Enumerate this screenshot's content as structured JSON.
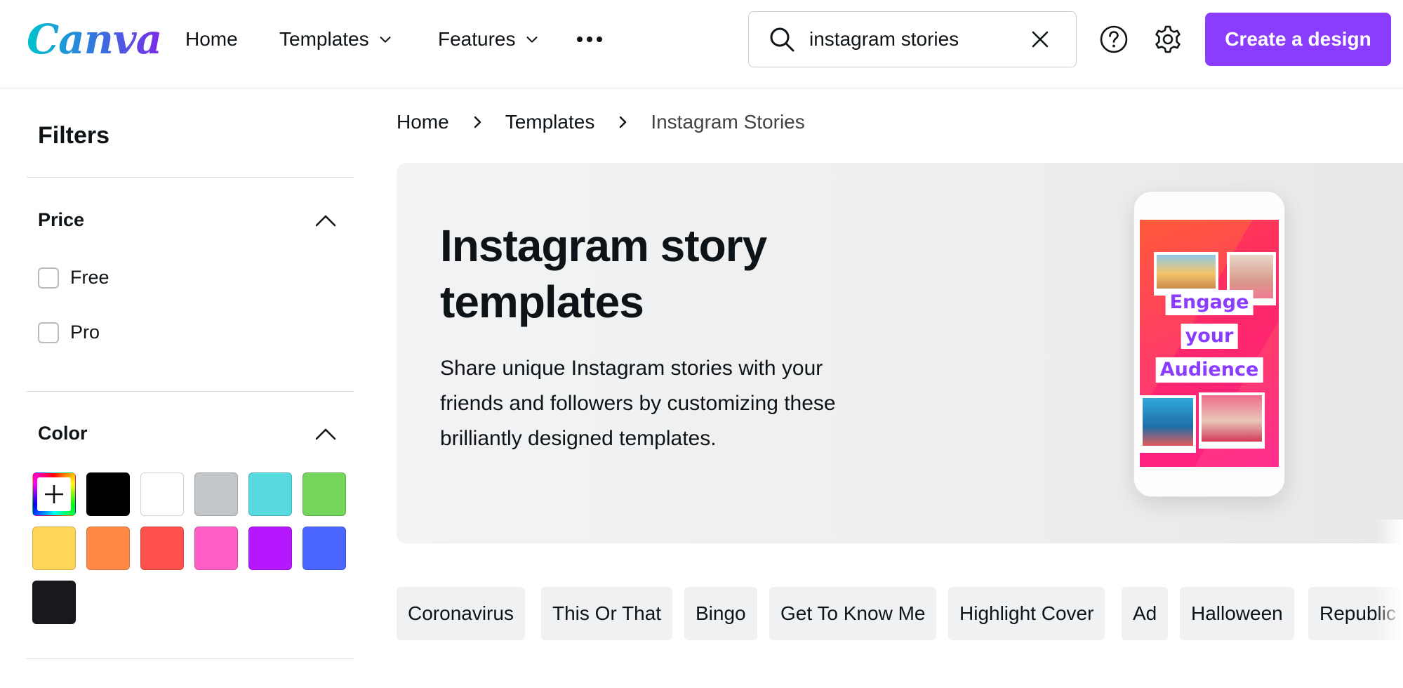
{
  "header": {
    "logo_text": "Canva",
    "nav": [
      {
        "label": "Home",
        "has_dropdown": false
      },
      {
        "label": "Templates",
        "has_dropdown": true
      },
      {
        "label": "Features",
        "has_dropdown": true
      }
    ],
    "more_icon": "more-horizontal-icon",
    "search": {
      "value": "instagram stories",
      "placeholder": "Search"
    },
    "icons": [
      "search-icon",
      "close-icon",
      "help-icon",
      "gear-icon"
    ],
    "cta_label": "Create a design",
    "accent_color": "#8b3dff"
  },
  "sidebar": {
    "title": "Filters",
    "price": {
      "title": "Price",
      "options": [
        {
          "label": "Free",
          "checked": false
        },
        {
          "label": "Pro",
          "checked": false
        }
      ]
    },
    "color": {
      "title": "Color",
      "swatches": [
        "custom",
        "#000000",
        "#ffffff",
        "#c4c7ca",
        "#57d9e0",
        "#73d559",
        "#ffd659",
        "#ff8a48",
        "#ff524e",
        "#ff5ec6",
        "#b517ff",
        "#4b66ff",
        "#17191c"
      ]
    }
  },
  "breadcrumb": {
    "items": [
      "Home",
      "Templates",
      "Instagram Stories"
    ]
  },
  "hero": {
    "title": "Instagram story templates",
    "description": "Share unique Instagram stories with your friends and followers by customizing these brilliantly designed templates.",
    "promo_words": [
      "Engage",
      "your",
      "Audience"
    ]
  },
  "chips": [
    "Coronavirus",
    "This Or That",
    "Bingo",
    "Get To Know Me",
    "Highlight Cover",
    "Ad",
    "Halloween",
    "Republic"
  ]
}
